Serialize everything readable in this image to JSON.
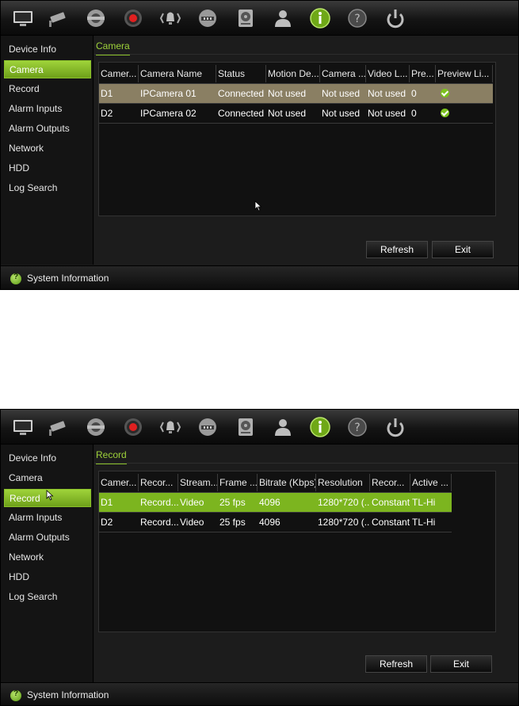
{
  "toolbar": {
    "icons": [
      "monitor-icon",
      "camera-icon",
      "ptz-icon",
      "record-icon",
      "alarm-icon",
      "network-icon",
      "hdd-icon",
      "user-icon",
      "info-icon",
      "help-icon",
      "power-icon"
    ]
  },
  "sidebar": {
    "items": [
      {
        "label": "Device Info"
      },
      {
        "label": "Camera"
      },
      {
        "label": "Record"
      },
      {
        "label": "Alarm Inputs"
      },
      {
        "label": "Alarm Outputs"
      },
      {
        "label": "Network"
      },
      {
        "label": "HDD"
      },
      {
        "label": "Log Search"
      }
    ]
  },
  "camera_view": {
    "tab": "Camera",
    "active_sidebar": "Camera",
    "columns": [
      "Camer...",
      "Camera Name",
      "Status",
      "Motion De...",
      "Camera ...",
      "Video L...",
      "Pre...",
      "Preview Li..."
    ],
    "rows": [
      {
        "camera": "D1",
        "name": "IPCamera 01",
        "status": "Connected",
        "motion": "Not used",
        "camera_x": "Not used",
        "video": "Not used",
        "pre": "0",
        "preview": "check"
      },
      {
        "camera": "D2",
        "name": "IPCamera 02",
        "status": "Connected",
        "motion": "Not used",
        "camera_x": "Not used",
        "video": "Not used",
        "pre": "0",
        "preview": "check"
      }
    ],
    "refresh_label": "Refresh",
    "exit_label": "Exit",
    "status_text": "System Information"
  },
  "record_view": {
    "tab": "Record",
    "active_sidebar": "Record",
    "columns": [
      "Camer...",
      "Recor...",
      "Stream...",
      "Frame ...",
      "Bitrate (Kbps)",
      "Resolution",
      "Recor...",
      "Active ..."
    ],
    "rows": [
      {
        "camera": "D1",
        "record": "Record...",
        "stream": "Video",
        "frame": "25 fps",
        "bitrate": "4096",
        "resolution": "1280*720 (...",
        "rec_type": "Constant",
        "active": "TL-Hi"
      },
      {
        "camera": "D2",
        "record": "Record...",
        "stream": "Video",
        "frame": "25 fps",
        "bitrate": "4096",
        "resolution": "1280*720 (...",
        "rec_type": "Constant",
        "active": "TL-Hi"
      }
    ],
    "refresh_label": "Refresh",
    "exit_label": "Exit",
    "status_text": "System Information"
  },
  "colors": {
    "accent_green": "#8bc12a",
    "selected_row_camera": "#8a7f63",
    "selected_row_record": "#7cb51f"
  }
}
